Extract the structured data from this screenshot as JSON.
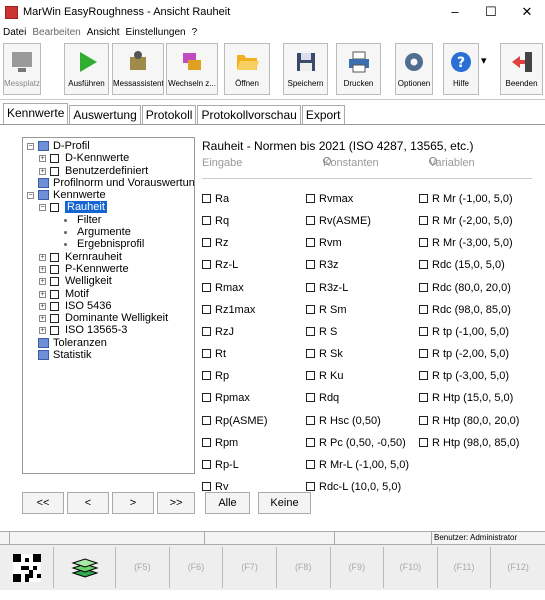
{
  "window": {
    "title": "MarWin EasyRoughness - Ansicht Rauheit",
    "minimize": "–",
    "maximize": "☐",
    "close": "✕"
  },
  "menu": [
    "Datei",
    "Bearbeiten",
    "Ansicht",
    "Einstellungen",
    "?"
  ],
  "toolbar": [
    {
      "label": "Messplatz",
      "icon": "monitor-icon",
      "color": "#999999"
    },
    {
      "label": "Ausführen",
      "icon": "play-icon",
      "color": "#2fae2f"
    },
    {
      "label": "Messassistent",
      "icon": "wizard-icon",
      "color": "#7a6a3a"
    },
    {
      "label": "Wechseln z...",
      "icon": "switch-icon",
      "color": "#c04cc0"
    },
    {
      "label": "Öffnen",
      "icon": "folder-icon",
      "color": "#f0b020"
    },
    {
      "label": "Speichern",
      "icon": "save-icon",
      "color": "#3a4a6a"
    },
    {
      "label": "Drucken",
      "icon": "printer-icon",
      "color": "#3a6fb0"
    },
    {
      "label": "Optionen",
      "icon": "gear-icon",
      "color": "#506e90"
    },
    {
      "label": "Hilfe",
      "icon": "help-icon",
      "color": "#2a6fd6"
    },
    {
      "label": "Beenden",
      "icon": "exit-icon",
      "color": "#e04040"
    }
  ],
  "help_dropdown": "▾",
  "tabs": [
    "Kennwerte",
    "Auswertung",
    "Protokoll",
    "Protokollvorschau",
    "Export"
  ],
  "tree": [
    {
      "text": "D-Profil",
      "kind": "folder",
      "level": 0,
      "expander": "−"
    },
    {
      "text": "D-Kennwerte",
      "kind": "check",
      "level": 1,
      "expander": "+"
    },
    {
      "text": "Benutzerdefiniert",
      "kind": "check",
      "level": 1,
      "expander": "+"
    },
    {
      "text": "Profilnorm und Vorauswertung",
      "kind": "folder",
      "level": 0,
      "expander": ""
    },
    {
      "text": "Kennwerte",
      "kind": "folder",
      "level": 0,
      "expander": "−"
    },
    {
      "text": "Rauheit",
      "kind": "check",
      "level": 1,
      "expander": "−",
      "selected": true
    },
    {
      "text": "Filter",
      "kind": "leaf",
      "level": 2,
      "expander": ""
    },
    {
      "text": "Argumente",
      "kind": "leaf",
      "level": 2,
      "expander": ""
    },
    {
      "text": "Ergebnisprofil",
      "kind": "leaf",
      "level": 2,
      "expander": ""
    },
    {
      "text": "Kernrauheit",
      "kind": "check",
      "level": 1,
      "expander": "+"
    },
    {
      "text": "P-Kennwerte",
      "kind": "check",
      "level": 1,
      "expander": "+"
    },
    {
      "text": "Welligkeit",
      "kind": "check",
      "level": 1,
      "expander": "+"
    },
    {
      "text": "Motif",
      "kind": "check",
      "level": 1,
      "expander": "+"
    },
    {
      "text": "ISO 5436",
      "kind": "check",
      "level": 1,
      "expander": "+"
    },
    {
      "text": "Dominante Welligkeit",
      "kind": "check",
      "level": 1,
      "expander": "+"
    },
    {
      "text": "ISO 13565-3",
      "kind": "check",
      "level": 1,
      "expander": "+"
    },
    {
      "text": "Toleranzen",
      "kind": "folder",
      "level": 0,
      "expander": ""
    },
    {
      "text": "Statistik",
      "kind": "folder",
      "level": 0,
      "expander": ""
    }
  ],
  "nav_buttons": [
    "<<",
    "<",
    ">",
    ">>"
  ],
  "all_button": "Alle",
  "none_button": "Keine",
  "heading": "Rauheit  -  Normen bis 2021 (ISO 4287, 13565, etc.)",
  "radios": {
    "input": "Eingabe",
    "constants": "Konstanten",
    "variables": "Variablen"
  },
  "params": [
    [
      "Ra",
      "Rq",
      "Rz",
      "Rz-L",
      "Rmax",
      "Rz1max",
      "RzJ",
      "Rt",
      "Rp",
      "Rpmax",
      "Rp(ASME)",
      "Rpm",
      "Rp-L",
      "Rv"
    ],
    [
      "Rvmax",
      "Rv(ASME)",
      "Rvm",
      "R3z",
      "R3z-L",
      "R Sm",
      "R S",
      "R Sk",
      "R Ku",
      "Rdq",
      "R Hsc (0,50)",
      "R Pc (0,50, -0,50)",
      "R Mr-L (-1,00, 5,0)",
      "Rdc-L (10,0, 5,0)"
    ],
    [
      "R Mr (-1,00, 5,0)",
      "R Mr (-2,00, 5,0)",
      "R Mr (-3,00, 5,0)",
      "Rdc (15,0, 5,0)",
      "Rdc (80,0, 20,0)",
      "Rdc (98,0, 85,0)",
      "R tp (-1,00, 5,0)",
      "R tp (-2,00, 5,0)",
      "R tp (-3,00, 5,0)",
      "R Htp (15,0, 5,0)",
      "R Htp (80,0, 20,0)",
      "R Htp (98,0, 85,0)"
    ]
  ],
  "status": {
    "user": "Benutzer: Administrator"
  },
  "fkeys": [
    "(F5)",
    "(F6)",
    "(F7)",
    "(F8)",
    "(F9)",
    "(F10)",
    "(F11)",
    "(F12)"
  ]
}
